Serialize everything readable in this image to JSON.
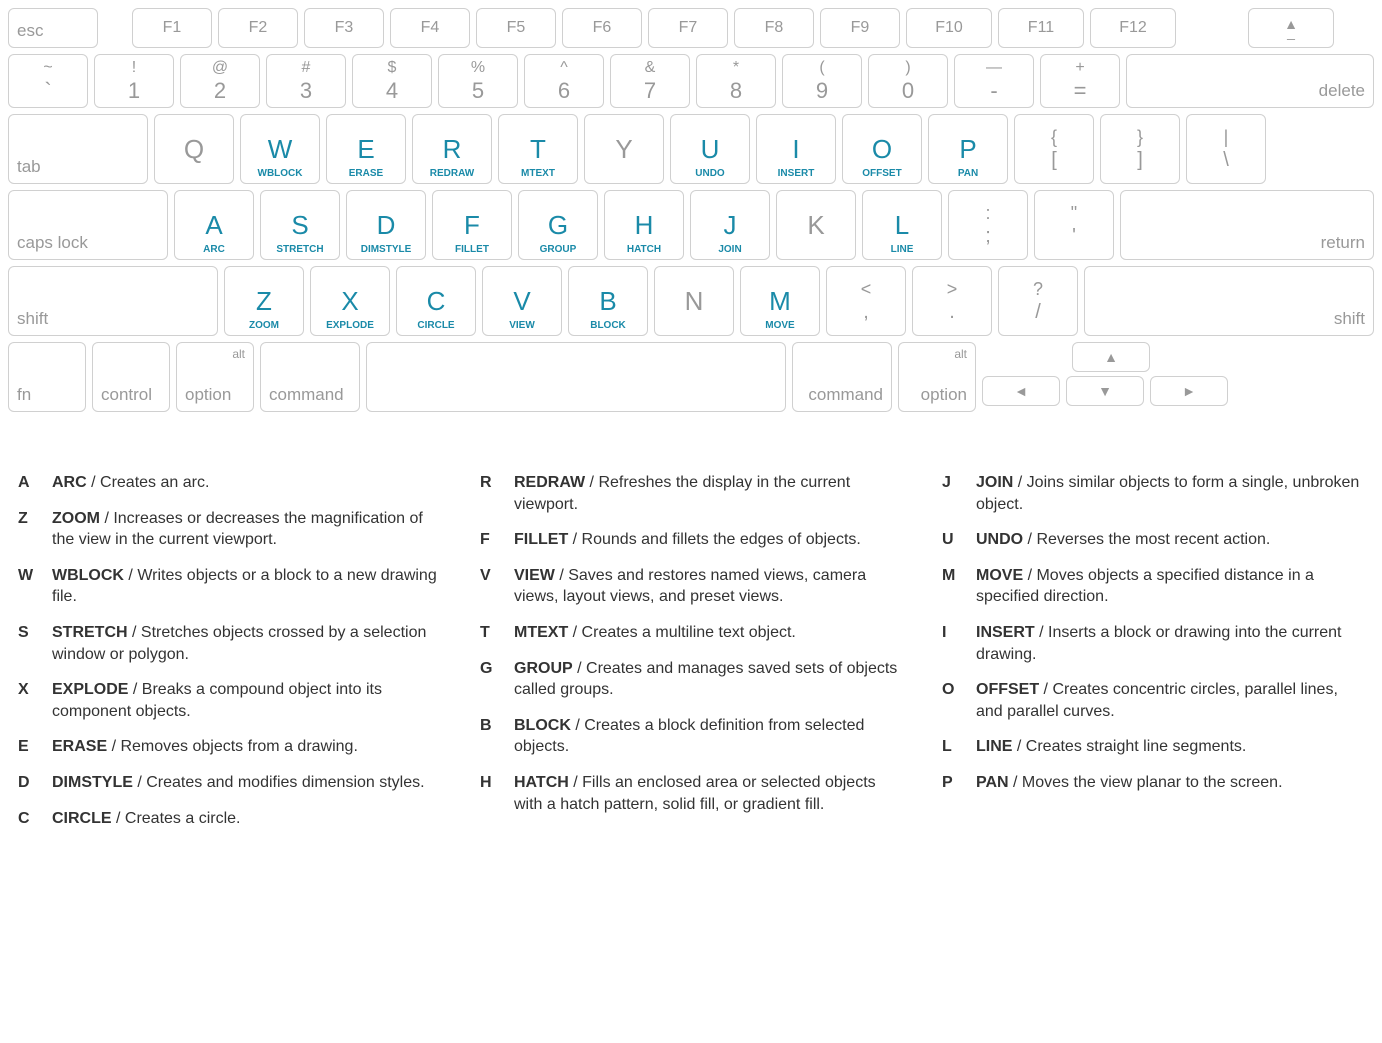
{
  "colors": {
    "highlight": "#1a8aa8",
    "muted": "#999999"
  },
  "fn_row": [
    "esc",
    "F1",
    "F2",
    "F3",
    "F4",
    "F5",
    "F6",
    "F7",
    "F8",
    "F9",
    "F10",
    "F11",
    "F12",
    "eject"
  ],
  "num_row": [
    {
      "top": "~",
      "bot": "`"
    },
    {
      "top": "!",
      "bot": "1"
    },
    {
      "top": "@",
      "bot": "2"
    },
    {
      "top": "#",
      "bot": "3"
    },
    {
      "top": "$",
      "bot": "4"
    },
    {
      "top": "%",
      "bot": "5"
    },
    {
      "top": "^",
      "bot": "6"
    },
    {
      "top": "&",
      "bot": "7"
    },
    {
      "top": "*",
      "bot": "8"
    },
    {
      "top": "(",
      "bot": "9"
    },
    {
      "top": ")",
      "bot": "0"
    },
    {
      "top": "—",
      "bot": "-"
    },
    {
      "top": "+",
      "bot": "="
    }
  ],
  "delete": "delete",
  "tab": "tab",
  "qwerty": [
    {
      "l": "Q",
      "cmd": ""
    },
    {
      "l": "W",
      "cmd": "WBLOCK"
    },
    {
      "l": "E",
      "cmd": "ERASE"
    },
    {
      "l": "R",
      "cmd": "REDRAW"
    },
    {
      "l": "T",
      "cmd": "MTEXT"
    },
    {
      "l": "Y",
      "cmd": ""
    },
    {
      "l": "U",
      "cmd": "UNDO"
    },
    {
      "l": "I",
      "cmd": "INSERT"
    },
    {
      "l": "O",
      "cmd": "OFFSET"
    },
    {
      "l": "P",
      "cmd": "PAN"
    }
  ],
  "brackets": [
    {
      "top": "{",
      "bot": "["
    },
    {
      "top": "}",
      "bot": "]"
    },
    {
      "top": "|",
      "bot": "\\"
    }
  ],
  "caps": "caps lock",
  "asdf": [
    {
      "l": "A",
      "cmd": "ARC"
    },
    {
      "l": "S",
      "cmd": "STRETCH"
    },
    {
      "l": "D",
      "cmd": "DIMSTYLE"
    },
    {
      "l": "F",
      "cmd": "FILLET"
    },
    {
      "l": "G",
      "cmd": "GROUP"
    },
    {
      "l": "H",
      "cmd": "HATCH"
    },
    {
      "l": "J",
      "cmd": "JOIN"
    },
    {
      "l": "K",
      "cmd": ""
    },
    {
      "l": "L",
      "cmd": "LINE"
    }
  ],
  "semicolon": {
    "top": ":",
    "bot": ";"
  },
  "quote": {
    "top": "\"",
    "bot": "'"
  },
  "return": "return",
  "shift": "shift",
  "zxcv": [
    {
      "l": "Z",
      "cmd": "ZOOM"
    },
    {
      "l": "X",
      "cmd": "EXPLODE"
    },
    {
      "l": "C",
      "cmd": "CIRCLE"
    },
    {
      "l": "V",
      "cmd": "VIEW"
    },
    {
      "l": "B",
      "cmd": "BLOCK"
    },
    {
      "l": "N",
      "cmd": ""
    },
    {
      "l": "M",
      "cmd": "MOVE"
    }
  ],
  "comma": {
    "top": "<",
    "bot": ","
  },
  "period": {
    "top": ">",
    "bot": "."
  },
  "slash": {
    "top": "?",
    "bot": "/"
  },
  "bottom": {
    "fn": "fn",
    "control": "control",
    "alt": "alt",
    "option": "option",
    "command": "command"
  },
  "arrows": {
    "up": "▲",
    "down": "▼",
    "left": "◄",
    "right": "►"
  },
  "legend_cols": [
    [
      {
        "k": "A",
        "cmd": "ARC",
        "desc": "Creates an arc."
      },
      {
        "k": "Z",
        "cmd": "ZOOM",
        "desc": "Increases or decreases the magnification of the view in the current viewport."
      },
      {
        "k": "W",
        "cmd": "WBLOCK",
        "desc": "Writes objects or a block to a new drawing file."
      },
      {
        "k": "S",
        "cmd": "STRETCH",
        "desc": "Stretches objects crossed by a selection window or polygon."
      },
      {
        "k": "X",
        "cmd": "EXPLODE",
        "desc": "Breaks a compound object into its component objects."
      },
      {
        "k": "E",
        "cmd": "ERASE",
        "desc": "Removes objects from a drawing."
      },
      {
        "k": "D",
        "cmd": "DIMSTYLE",
        "desc": "Creates and modifies dimension styles."
      },
      {
        "k": "C",
        "cmd": "CIRCLE",
        "desc": "Creates a circle."
      }
    ],
    [
      {
        "k": "R",
        "cmd": "REDRAW",
        "desc": "Refreshes the display in the current viewport."
      },
      {
        "k": "F",
        "cmd": "FILLET",
        "desc": "Rounds and fillets the edges of objects."
      },
      {
        "k": "V",
        "cmd": "VIEW",
        "desc": "Saves and restores named views, camera views, layout views, and preset views."
      },
      {
        "k": "T",
        "cmd": "MTEXT",
        "desc": "Creates a multiline text object."
      },
      {
        "k": "G",
        "cmd": "GROUP",
        "desc": "Creates and manages saved sets of objects called groups."
      },
      {
        "k": "B",
        "cmd": "BLOCK",
        "desc": "Creates a block definition from selected objects."
      },
      {
        "k": "H",
        "cmd": "HATCH",
        "desc": "Fills an enclosed area or selected objects with a hatch pattern, solid fill, or gradient fill."
      }
    ],
    [
      {
        "k": "J",
        "cmd": "JOIN",
        "desc": "Joins similar objects to form a single, unbroken object."
      },
      {
        "k": "U",
        "cmd": "UNDO",
        "desc": "Reverses the most recent action."
      },
      {
        "k": "M",
        "cmd": "MOVE",
        "desc": "Moves objects a specified distance in a specified direction."
      },
      {
        "k": "I",
        "cmd": "INSERT",
        "desc": "Inserts a block or drawing into the current drawing."
      },
      {
        "k": "O",
        "cmd": "OFFSET",
        "desc": "Creates concentric circles, parallel lines, and parallel curves."
      },
      {
        "k": "L",
        "cmd": "LINE",
        "desc": "Creates straight line segments."
      },
      {
        "k": "P",
        "cmd": "PAN",
        "desc": "Moves the view planar to the screen."
      }
    ]
  ]
}
